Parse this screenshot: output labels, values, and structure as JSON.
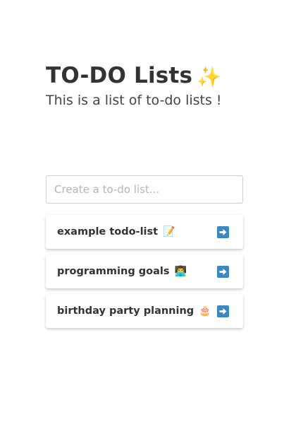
{
  "header": {
    "title": "TO-DO Lists",
    "title_emoji": "✨",
    "subtitle": "This is a list of to-do lists !"
  },
  "create": {
    "placeholder": "Create a to-do list...",
    "value": ""
  },
  "lists": [
    {
      "label": "example todo-list",
      "emoji": "📝",
      "icon": "right-arrow-icon"
    },
    {
      "label": "programming goals",
      "emoji": "👨‍💻",
      "icon": "right-arrow-icon"
    },
    {
      "label": "birthday party planning",
      "emoji": "🎂",
      "icon": "right-arrow-icon"
    }
  ],
  "colors": {
    "text": "#333333",
    "arrow_button": "#3b88c3",
    "input_border": "#cfcfcf",
    "placeholder": "#b5b5b5"
  }
}
